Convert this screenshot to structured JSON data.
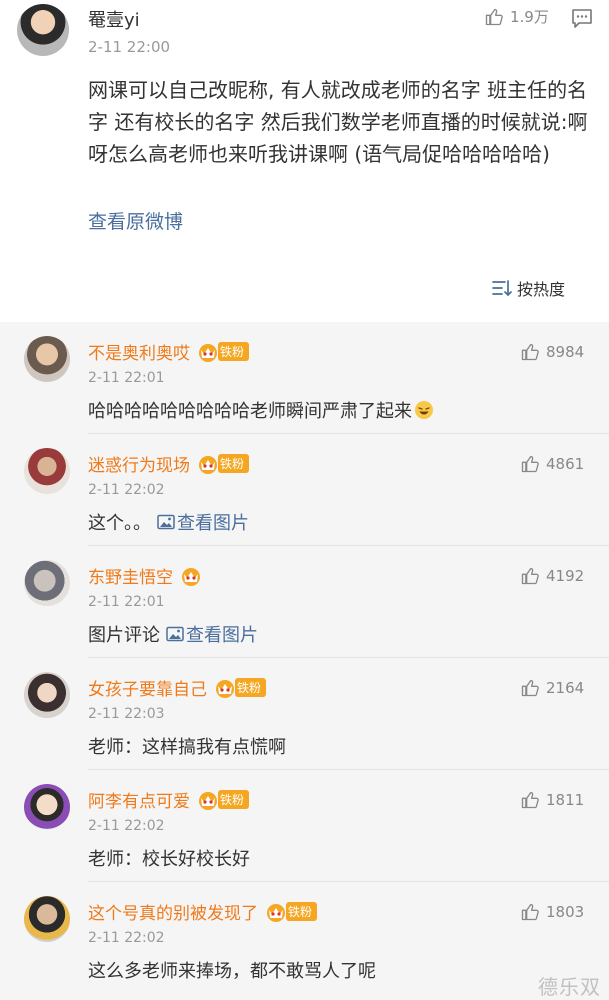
{
  "post": {
    "author": "罨壹yi",
    "time": "2-11 22:00",
    "likes": "1.9万",
    "text": "网课可以自己改昵称, 有人就改成老师的名字 班主任的名字 还有校长的名字 然后我们数学老师直播的时候就说:啊呀怎么高老师也来听我讲课啊 (语气局促哈哈哈哈哈)",
    "view_original": "查看原微博",
    "sort_label": "按热度"
  },
  "comments": [
    {
      "name": "不是奥利奥哎",
      "time": "2-11 22:01",
      "likes": "8984",
      "text": "哈哈哈哈哈哈哈哈哈老师瞬间严肃了起来",
      "badge": "铁粉",
      "has_emoji": true
    },
    {
      "name": "迷惑行为现场",
      "time": "2-11 22:02",
      "likes": "4861",
      "text": "这个。。",
      "badge": "铁粉",
      "link": "查看图片"
    },
    {
      "name": "东野圭悟空",
      "time": "2-11 22:01",
      "likes": "4192",
      "text": "图片评论",
      "badge": "",
      "link": "查看图片"
    },
    {
      "name": "女孩子要靠自己",
      "time": "2-11 22:03",
      "likes": "2164",
      "text": "老师：这样搞我有点慌啊",
      "badge": "铁粉"
    },
    {
      "name": "阿李有点可爱",
      "time": "2-11 22:02",
      "likes": "1811",
      "text": "老师：校长好校长好",
      "badge": "铁粉"
    },
    {
      "name": "这个号真的别被发现了",
      "time": "2-11 22:02",
      "likes": "1803",
      "text": "这么多老师来捧场，都不敢骂人了呢",
      "badge": "铁粉"
    }
  ],
  "watermark": "德乐双",
  "colors": {
    "accent_name": "#f07a1a",
    "link": "#4a6f9d",
    "badge": "#f5a623",
    "list_bg": "#f5f5f5"
  }
}
